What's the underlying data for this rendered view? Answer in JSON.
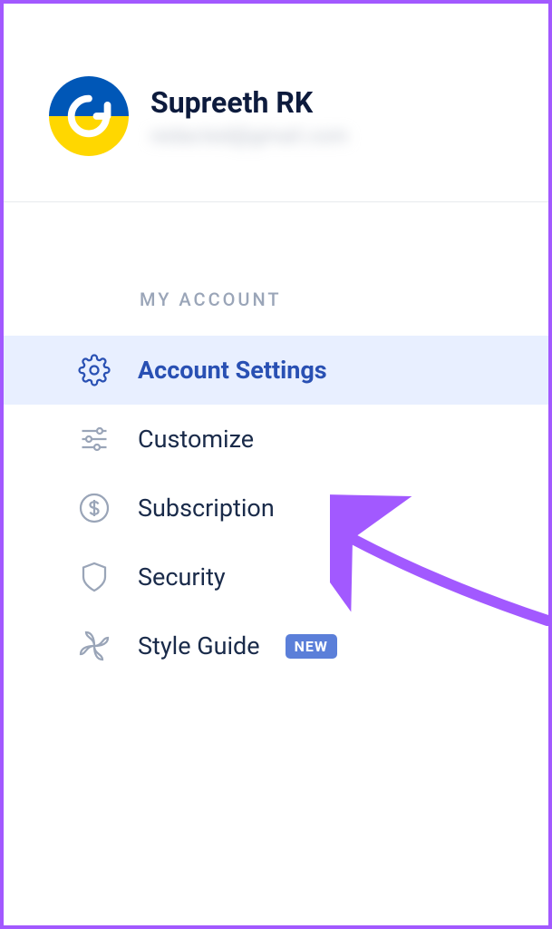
{
  "profile": {
    "name": "Supreeth RK",
    "email": "redacted@gmail.com"
  },
  "section": {
    "header": "MY ACCOUNT"
  },
  "menu": {
    "items": [
      {
        "label": "Account Settings",
        "icon": "gear-icon",
        "active": true
      },
      {
        "label": "Customize",
        "icon": "sliders-icon"
      },
      {
        "label": "Subscription",
        "icon": "dollar-icon"
      },
      {
        "label": "Security",
        "icon": "shield-icon"
      },
      {
        "label": "Style Guide",
        "icon": "pinwheel-icon",
        "badge": "NEW"
      }
    ]
  }
}
